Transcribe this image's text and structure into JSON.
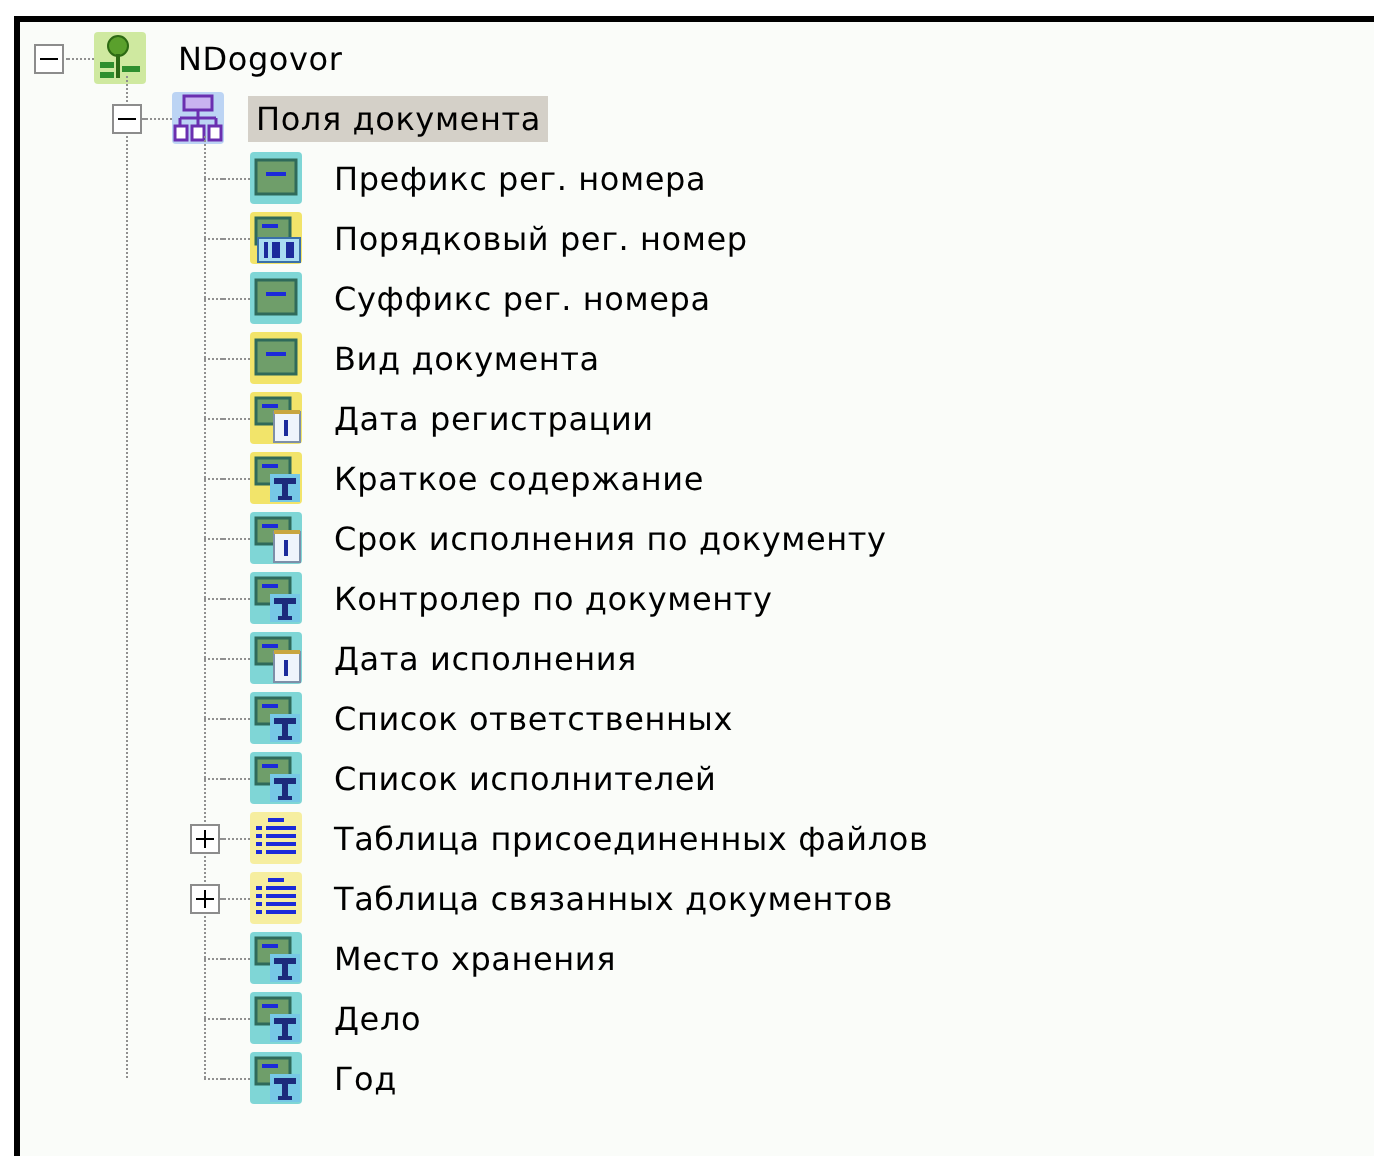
{
  "tree": [
    {
      "label": "NDogovor",
      "kind": "root",
      "expanded": true,
      "selected": false,
      "children": [
        {
          "label": "Поля документа",
          "kind": "group",
          "expanded": true,
          "selected": true,
          "children": [
            {
              "label": "Префикс рег. номера",
              "kind": "field",
              "color": "#7fd6d6"
            },
            {
              "label": "Порядковый рег. номер",
              "kind": "number",
              "color": "#f2e46a"
            },
            {
              "label": "Суффикс рег. номера",
              "kind": "field",
              "color": "#7fd6d6"
            },
            {
              "label": "Вид документа",
              "kind": "field",
              "color": "#f2e46a"
            },
            {
              "label": "Дата регистрации",
              "kind": "date",
              "color": "#f2e46a"
            },
            {
              "label": "Краткое содержание",
              "kind": "text",
              "color": "#f2e46a"
            },
            {
              "label": "Срок исполнения по документу",
              "kind": "date",
              "color": "#7fd6d6"
            },
            {
              "label": "Контролер по документу",
              "kind": "text",
              "color": "#7fd6d6"
            },
            {
              "label": "Дата исполнения",
              "kind": "date",
              "color": "#7fd6d6"
            },
            {
              "label": "Список ответственных",
              "kind": "text",
              "color": "#7fd6d6"
            },
            {
              "label": "Список исполнителей",
              "kind": "text",
              "color": "#7fd6d6"
            },
            {
              "label": "Таблица присоединенных файлов",
              "kind": "table",
              "color": "#f6eea0",
              "expanded": false
            },
            {
              "label": "Таблица связанных документов",
              "kind": "table",
              "color": "#f6eea0",
              "expanded": false
            },
            {
              "label": "Место хранения",
              "kind": "text",
              "color": "#7fd6d6"
            },
            {
              "label": "Дело",
              "kind": "text",
              "color": "#7fd6d6"
            },
            {
              "label": "Год",
              "kind": "text",
              "color": "#7fd6d6"
            }
          ]
        }
      ]
    }
  ]
}
